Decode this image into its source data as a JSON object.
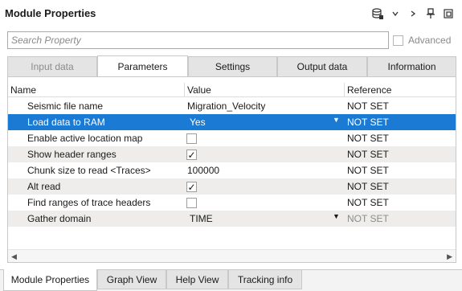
{
  "window": {
    "title": "Module Properties"
  },
  "toolbar": {
    "icons": [
      "database-icon",
      "chevron-down-icon",
      "chevron-right-icon",
      "pin-icon",
      "popout-icon"
    ]
  },
  "search": {
    "placeholder": "Search Property",
    "advanced_label": "Advanced",
    "advanced_checked": false
  },
  "tabs": [
    {
      "label": "Input data",
      "state": "disabled"
    },
    {
      "label": "Parameters",
      "state": "active"
    },
    {
      "label": "Settings",
      "state": "normal"
    },
    {
      "label": "Output data",
      "state": "normal"
    },
    {
      "label": "Information",
      "state": "normal"
    }
  ],
  "grid": {
    "columns": [
      "Name",
      "Value",
      "Reference"
    ],
    "rows": [
      {
        "name": "Seismic file name",
        "value": "Migration_Velocity",
        "type": "text",
        "reference": "NOT SET"
      },
      {
        "name": "Load data to RAM",
        "value": "Yes",
        "type": "dropdown",
        "reference": "NOT SET",
        "selected": true
      },
      {
        "name": "Enable active location map",
        "value": false,
        "type": "checkbox",
        "reference": "NOT SET"
      },
      {
        "name": "Show header ranges",
        "value": true,
        "type": "checkbox",
        "reference": "NOT SET"
      },
      {
        "name": "Chunk size to read <Traces>",
        "value": "100000",
        "type": "text",
        "reference": "NOT SET"
      },
      {
        "name": "Alt read",
        "value": true,
        "type": "checkbox",
        "reference": "NOT SET"
      },
      {
        "name": "Find ranges of trace headers",
        "value": false,
        "type": "checkbox",
        "reference": "NOT SET"
      },
      {
        "name": "Gather domain",
        "value": "TIME",
        "type": "dropdown",
        "reference": "NOT SET",
        "reference_dim": true
      }
    ]
  },
  "bottom_tabs": [
    {
      "label": "Module Properties",
      "active": true
    },
    {
      "label": "Graph View",
      "active": false
    },
    {
      "label": "Help View",
      "active": false
    },
    {
      "label": "Tracking info",
      "active": false
    }
  ],
  "colors": {
    "selection": "#1a7ad4",
    "alt_row": "#eeedeb",
    "tab_bg": "#e4e4e4"
  }
}
